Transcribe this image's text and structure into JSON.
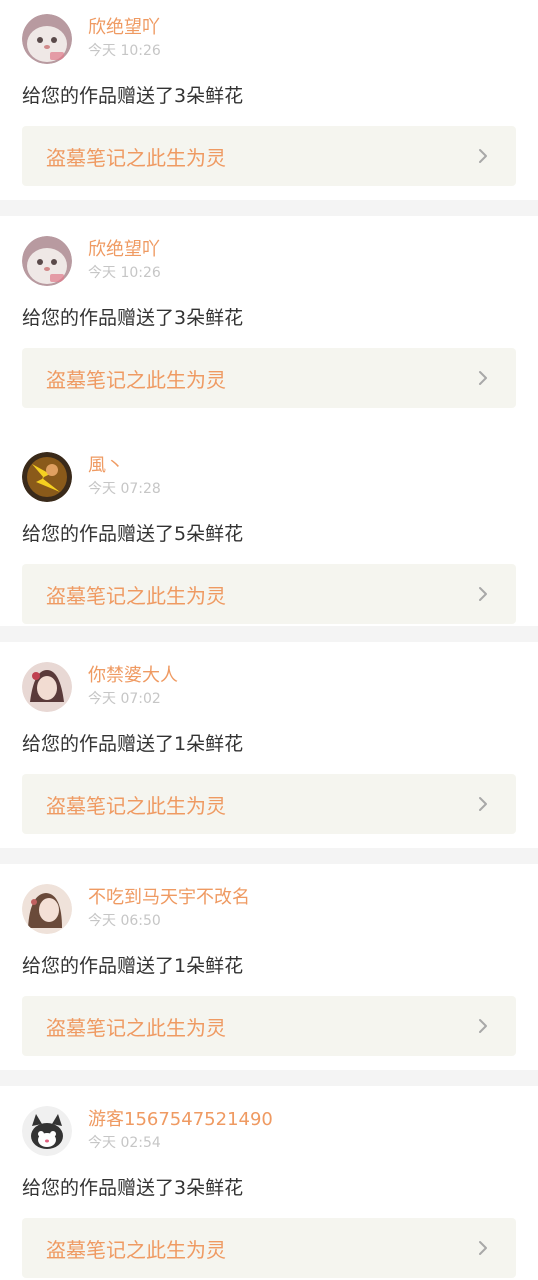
{
  "items": [
    {
      "user": "欣绝望吖",
      "time": "今天 10:26",
      "message": "给您的作品赠送了3朵鲜花",
      "work": "盗墓笔记之此生为灵",
      "avatar": "cat-photo-avatar"
    },
    {
      "user": "欣绝望吖",
      "time": "今天 10:26",
      "message": "给您的作品赠送了3朵鲜花",
      "work": "盗墓笔记之此生为灵",
      "avatar": "cat-photo-avatar"
    },
    {
      "user": "風丶",
      "time": "今天 07:28",
      "message": "给您的作品赠送了5朵鲜花",
      "work": "盗墓笔记之此生为灵",
      "avatar": "anime-lightning-avatar"
    },
    {
      "user": "你禁婆大人",
      "time": "今天 07:02",
      "message": "给您的作品赠送了1朵鲜花",
      "work": "盗墓笔记之此生为灵",
      "avatar": "girl-illustration-avatar"
    },
    {
      "user": "不吃到马天宇不改名",
      "time": "今天 06:50",
      "message": "给您的作品赠送了1朵鲜花",
      "work": "盗墓笔记之此生为灵",
      "avatar": "girl-illustration-avatar"
    },
    {
      "user": "游客1567547521490",
      "time": "今天 02:54",
      "message": "给您的作品赠送了3朵鲜花",
      "work": "盗墓笔记之此生为灵",
      "avatar": "cartoon-cat-avatar"
    }
  ],
  "colors": {
    "accent": "#ef9a62",
    "time": "#c6c6c6",
    "text": "#333333",
    "link_bg": "#f5f5ef",
    "separator": "#f4f4f4"
  }
}
